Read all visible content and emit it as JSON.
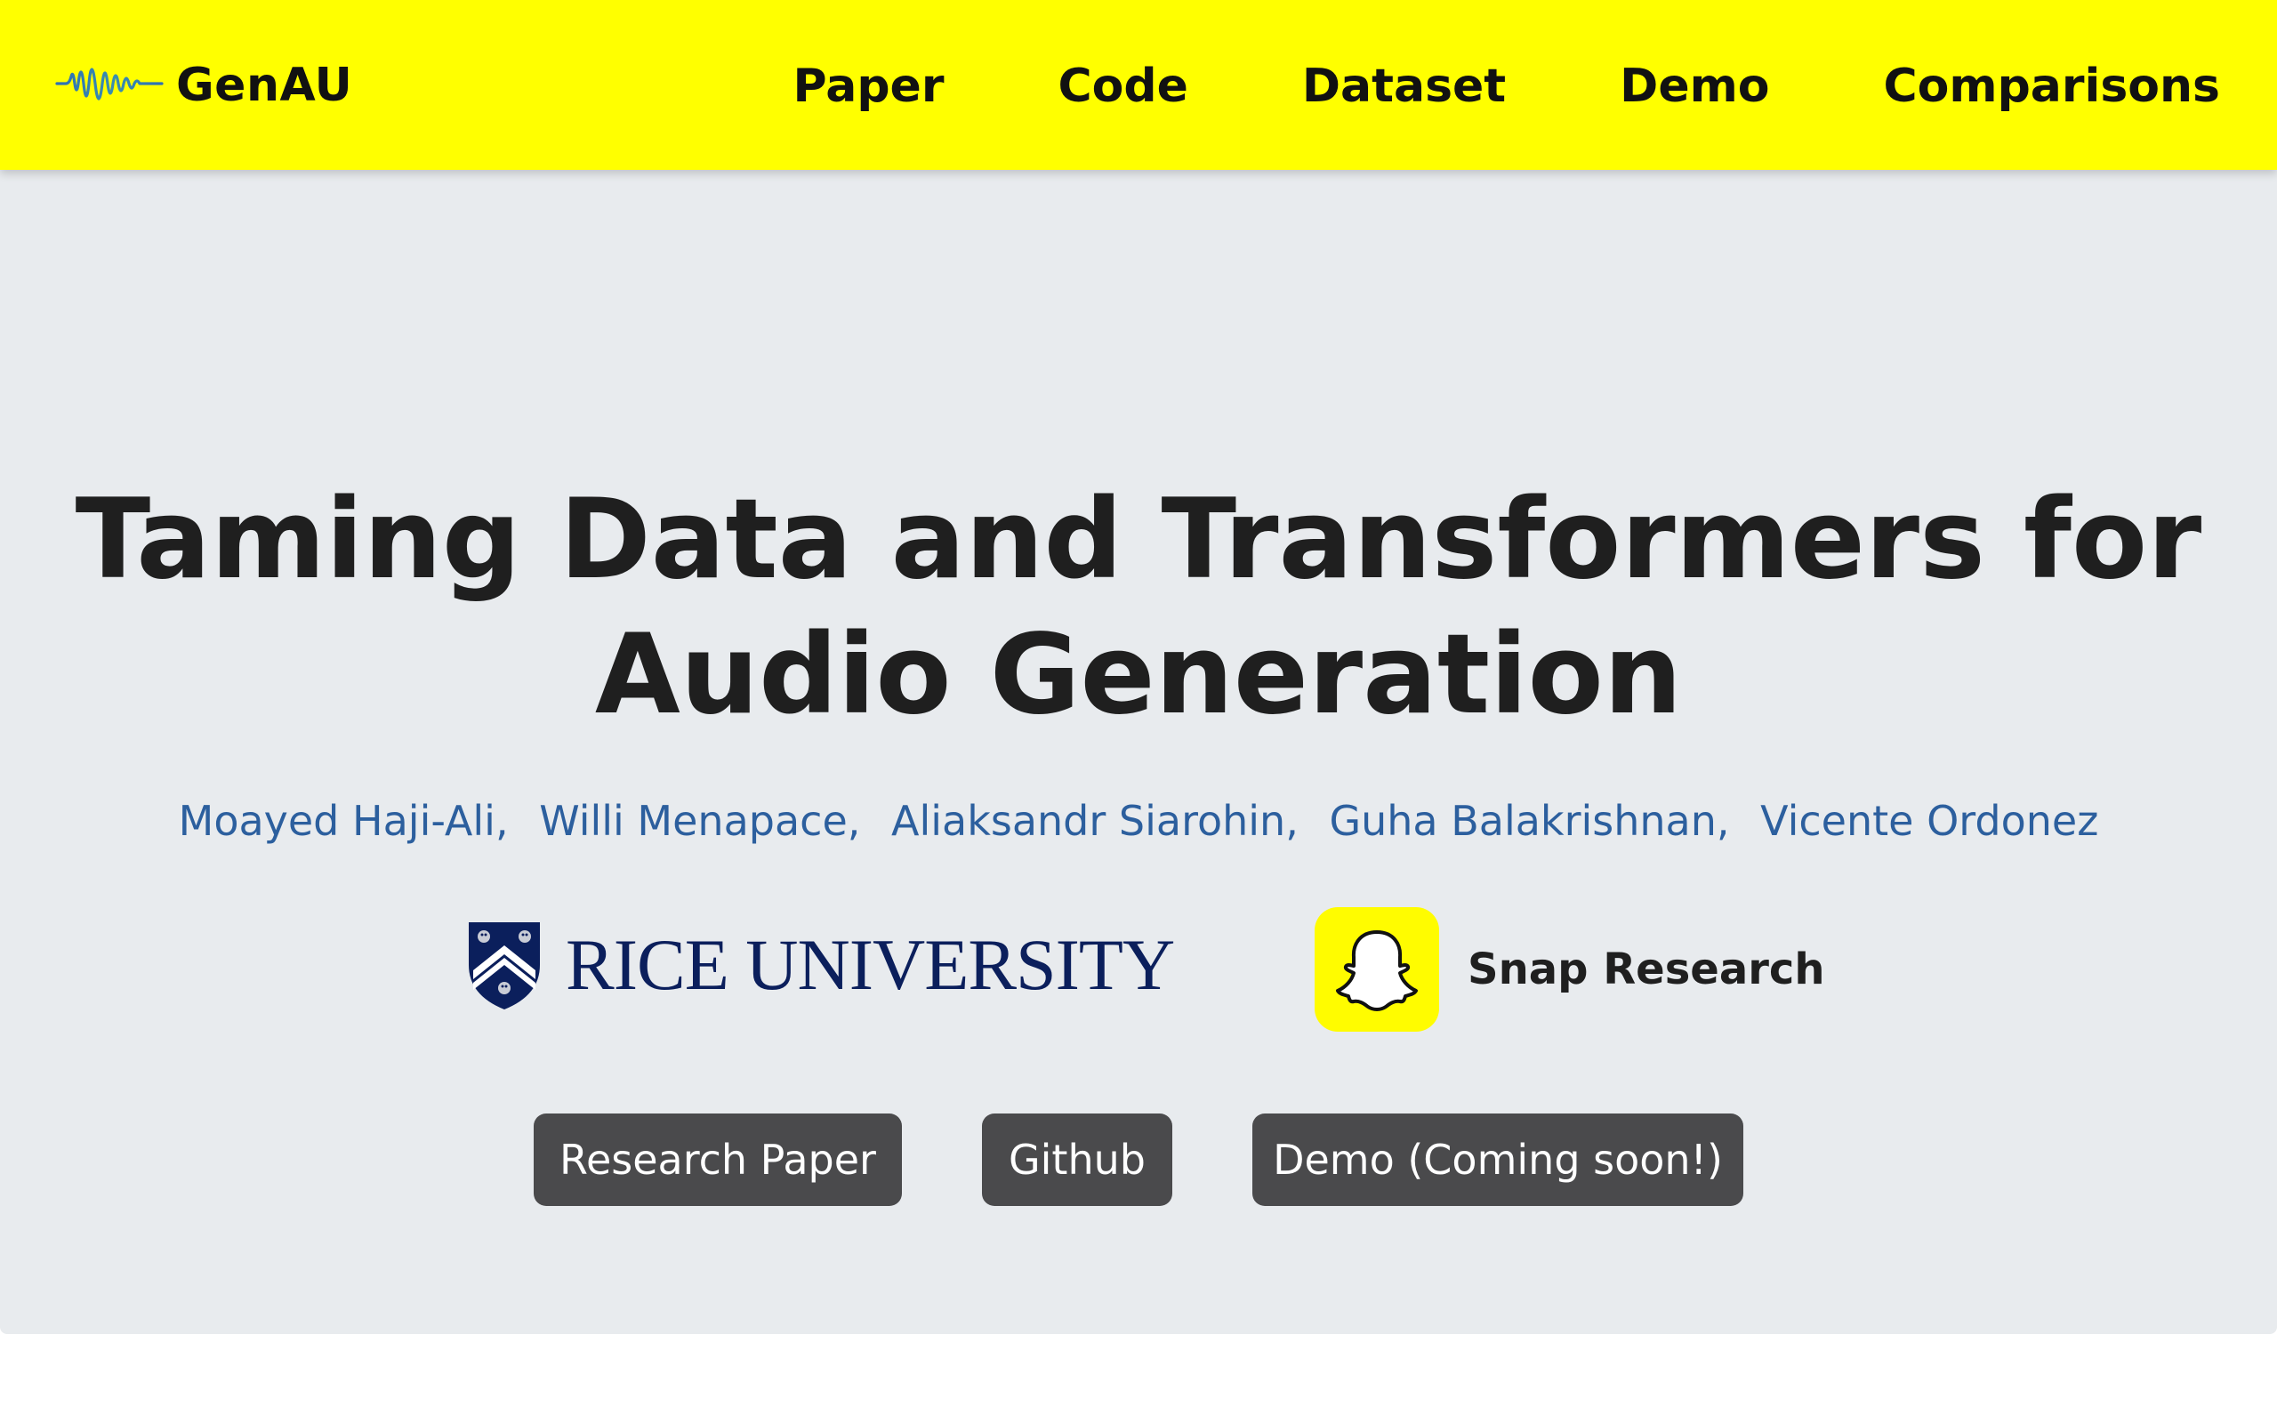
{
  "navbar": {
    "brand": "GenAU",
    "brand_icon": "waveform-icon",
    "background": "#ffff00",
    "links": [
      {
        "label": "Paper"
      },
      {
        "label": "Code"
      },
      {
        "label": "Dataset"
      },
      {
        "label": "Demo"
      },
      {
        "label": "Comparisons"
      }
    ]
  },
  "hero": {
    "background": "#e8ebee",
    "title_line1": "Taming Data and Transformers for",
    "title_line2": "Audio Generation",
    "authors": [
      {
        "name": "Moayed Haji-Ali"
      },
      {
        "name": "Willi Menapace"
      },
      {
        "name": "Aliaksandr Siarohin"
      },
      {
        "name": "Guha Balakrishnan"
      },
      {
        "name": "Vicente Ordonez"
      }
    ],
    "author_separator": ",",
    "author_color": "#2c5f9e",
    "affiliations": {
      "rice": {
        "name": "RICE UNIVERSITY",
        "icon": "rice-shield-icon",
        "color": "#0b1f5c"
      },
      "snap": {
        "name": "Snap Research",
        "icon": "snapchat-ghost-icon",
        "color": "#fffc00"
      }
    },
    "buttons": [
      {
        "label": "Research Paper"
      },
      {
        "label": "Github"
      },
      {
        "label": "Demo (Coming soon!)"
      }
    ],
    "button_color": "#4a4a4c"
  }
}
